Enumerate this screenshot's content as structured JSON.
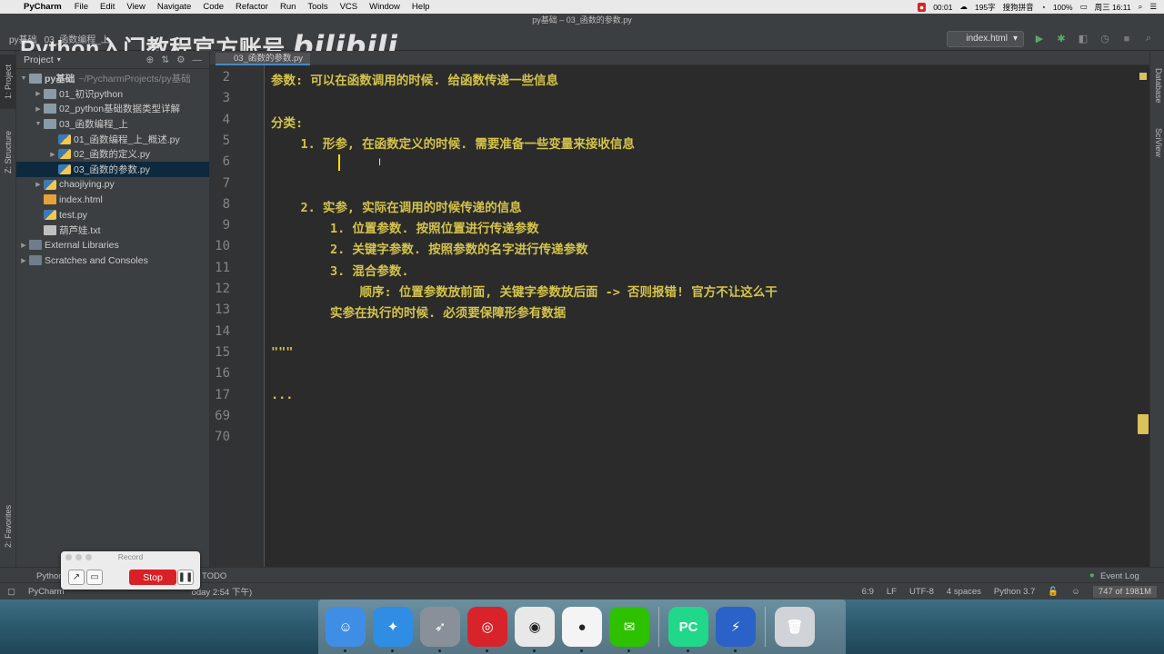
{
  "menubar": {
    "app_name": "PyCharm",
    "items": [
      "File",
      "Edit",
      "View",
      "Navigate",
      "Code",
      "Refactor",
      "Run",
      "Tools",
      "VCS",
      "Window",
      "Help"
    ],
    "status": {
      "record_time": "00:01",
      "temp": "195字",
      "input_method": "搜狗拼音",
      "battery": "100%",
      "clock": "周三 16:11"
    }
  },
  "window_title": "py基础 – 03_函数的参数.py",
  "navbar": {
    "breadcrumb_project": "py基础",
    "breadcrumb_folder": "03_函数编程_上",
    "watermark_text": "Python入门教程官方账号",
    "watermark_logo": "bilibili",
    "run_config": "index.html"
  },
  "side_tabs": {
    "project": "1: Project",
    "structure": "Z: Structure",
    "favorites": "2: Favorites",
    "database": "Database",
    "sciview": "SciView"
  },
  "project_panel": {
    "title": "Project",
    "tree": [
      {
        "label": "py基础",
        "dim": "~/PycharmProjects/py基础",
        "type": "folder",
        "indent": 0,
        "arrow": "▼"
      },
      {
        "label": "01_初识python",
        "type": "folder",
        "indent": 1,
        "arrow": "▶"
      },
      {
        "label": "02_python基础数据类型详解",
        "type": "folder",
        "indent": 1,
        "arrow": "▶"
      },
      {
        "label": "03_函数编程_上",
        "type": "folder",
        "indent": 1,
        "arrow": "▼"
      },
      {
        "label": "01_函数编程_上_概述.py",
        "type": "py",
        "indent": 2,
        "arrow": ""
      },
      {
        "label": "02_函数的定义.py",
        "type": "py",
        "indent": 2,
        "arrow": "▶"
      },
      {
        "label": "03_函数的参数.py",
        "type": "py",
        "indent": 2,
        "arrow": "",
        "selected": true
      },
      {
        "label": "chaojiying.py",
        "type": "py",
        "indent": 1,
        "arrow": "▶"
      },
      {
        "label": "index.html",
        "type": "html",
        "indent": 1,
        "arrow": ""
      },
      {
        "label": "test.py",
        "type": "py",
        "indent": 1,
        "arrow": ""
      },
      {
        "label": "葫芦娃.txt",
        "type": "txt",
        "indent": 1,
        "arrow": ""
      },
      {
        "label": "External Libraries",
        "type": "lib",
        "indent": 0,
        "arrow": "▶"
      },
      {
        "label": "Scratches and Consoles",
        "type": "lib",
        "indent": 0,
        "arrow": "▶"
      }
    ]
  },
  "editor": {
    "tab_label": "03_函数的参数.py",
    "lines": [
      {
        "num": "2",
        "text": "参数: 可以在函数调用的时候. 给函数传递一些信息"
      },
      {
        "num": "3",
        "text": ""
      },
      {
        "num": "4",
        "text": "分类:"
      },
      {
        "num": "5",
        "text": "    1. 形参, 在函数定义的时候. 需要准备一些变量来接收信息"
      },
      {
        "num": "6",
        "text": ""
      },
      {
        "num": "7",
        "text": ""
      },
      {
        "num": "8",
        "text": "    2. 实参, 实际在调用的时候传递的信息"
      },
      {
        "num": "9",
        "text": "        1. 位置参数. 按照位置进行传递参数"
      },
      {
        "num": "10",
        "text": "        2. 关键字参数. 按照参数的名字进行传递参数"
      },
      {
        "num": "11",
        "text": "        3. 混合参数."
      },
      {
        "num": "12",
        "text": "            顺序: 位置参数放前面, 关键字参数放后面 -> 否则报错! 官方不让这么干"
      },
      {
        "num": "13",
        "text": "        实参在执行的时候. 必须要保障形参有数据"
      },
      {
        "num": "14",
        "text": ""
      },
      {
        "num": "15",
        "text": "\"\"\""
      },
      {
        "num": "16",
        "text": ""
      },
      {
        "num": "17",
        "text": "..."
      },
      {
        "num": "69",
        "text": ""
      },
      {
        "num": "70",
        "text": ""
      }
    ]
  },
  "bottom_tools": {
    "python_console": "Python",
    "todo": "TODO",
    "event_log": "Event Log"
  },
  "statusbar": {
    "left": "PyCharm",
    "left_tail": "oday 2:54 下午)",
    "position": "6:9",
    "line_sep": "LF",
    "encoding": "UTF-8",
    "indent": "4 spaces",
    "interpreter": "Python 3.7",
    "memory": "747 of 1981M"
  },
  "recorder": {
    "title": "Record",
    "stop_label": "Stop"
  },
  "dock": {
    "apps": [
      {
        "name": "Finder",
        "color": "#3f8ee6",
        "glyph": "☺"
      },
      {
        "name": "Safari",
        "color": "#2f8de4",
        "glyph": "✦"
      },
      {
        "name": "Launchpad",
        "color": "#8a9099",
        "glyph": "➶"
      },
      {
        "name": "NetEase Music",
        "color": "#d8232a",
        "glyph": "◎"
      },
      {
        "name": "Chrome",
        "color": "#e8e8e8",
        "glyph": "◉"
      },
      {
        "name": "QQ",
        "color": "#f4f4f4",
        "glyph": "●"
      },
      {
        "name": "WeChat",
        "color": "#2dc100",
        "glyph": "✉"
      },
      {
        "name": "PyCharm",
        "color": "#21d789",
        "glyph": "PC"
      },
      {
        "name": "Reeder",
        "color": "#2b62c7",
        "glyph": "⚡"
      },
      {
        "name": "Trash",
        "color": "#d0d4d8",
        "glyph": "🗑"
      }
    ]
  }
}
